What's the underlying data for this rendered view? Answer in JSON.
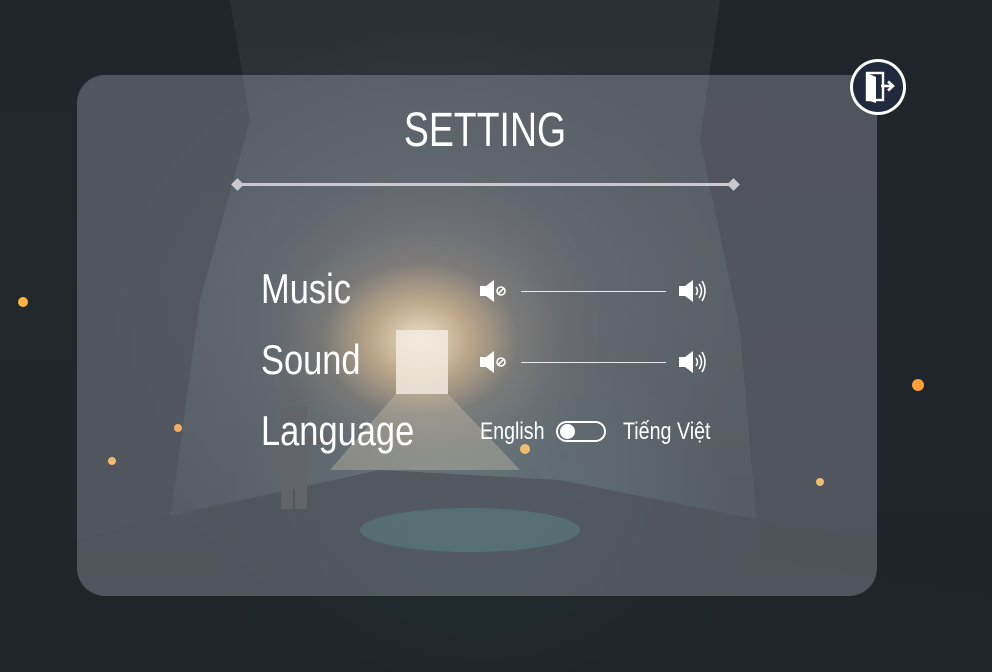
{
  "settings": {
    "title": "SETTING",
    "music_label": "Music",
    "sound_label": "Sound",
    "language_label": "Language",
    "language_option_left": "English",
    "language_option_right": "Tiếng Việt",
    "language_toggle_on_right": false
  },
  "icons": {
    "exit": "exit-door-icon",
    "volume_mute": "volume-mute-icon",
    "volume_max": "volume-max-icon"
  },
  "colors": {
    "panel": "#d2d2e1",
    "exit_button_fill": "#1f2b3d",
    "text": "#ffffff"
  }
}
